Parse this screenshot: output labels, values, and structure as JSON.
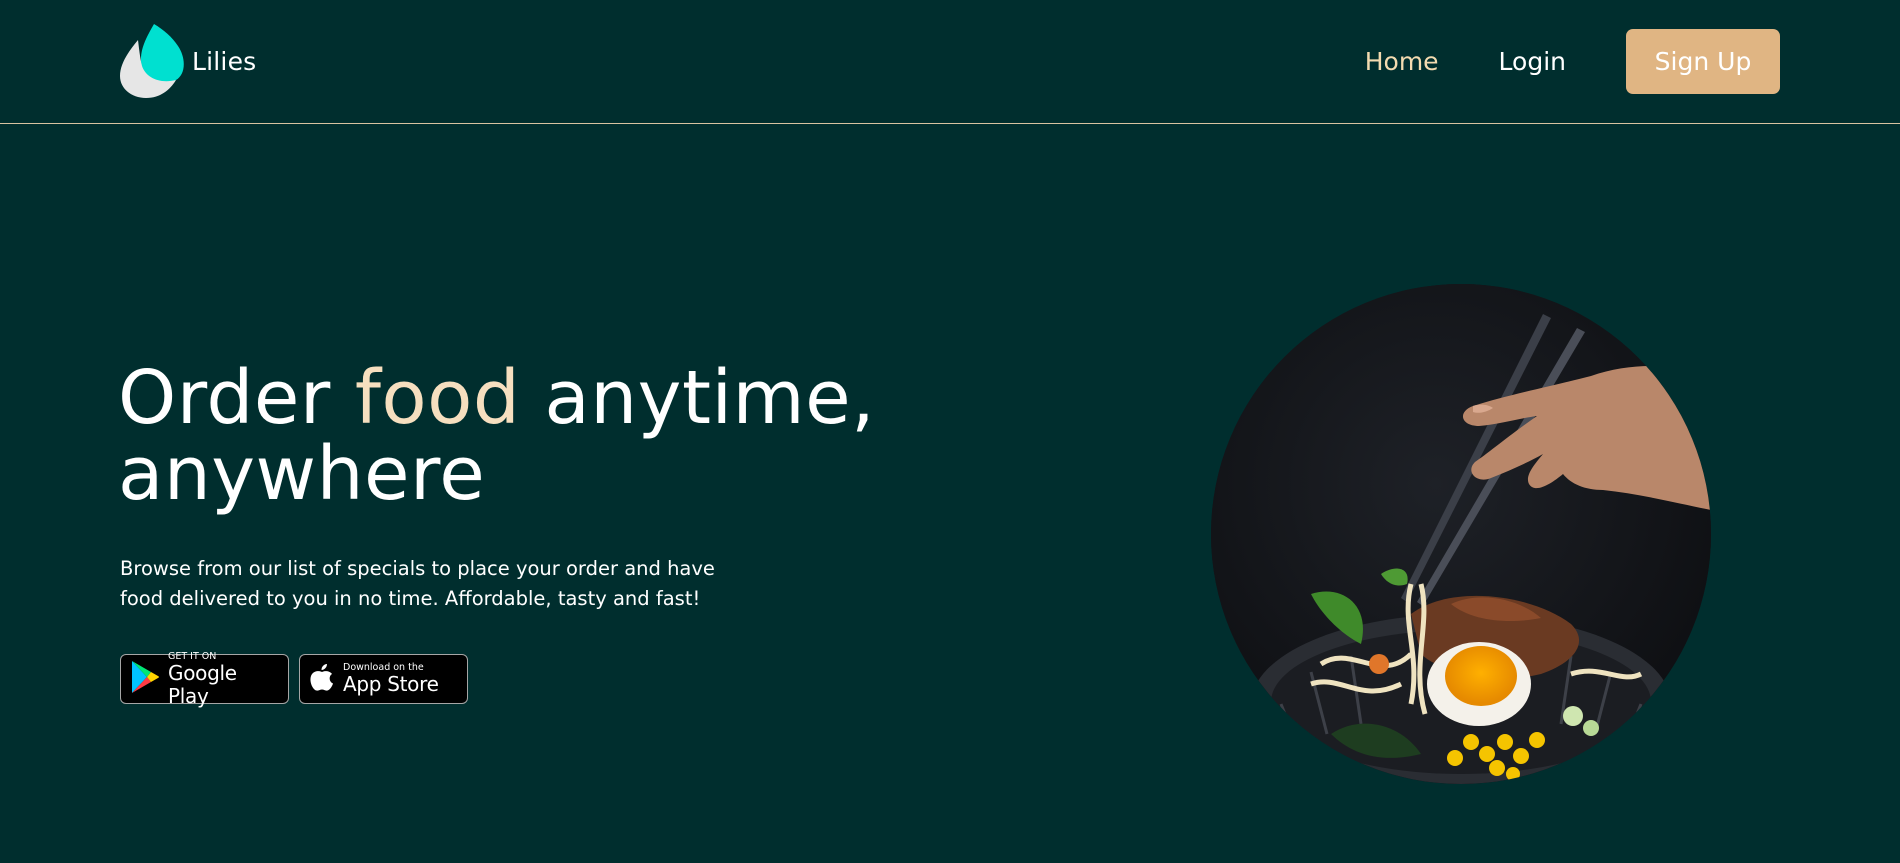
{
  "brand": {
    "name": "Lilies",
    "logo_icon": "leaf-drop-logo-icon",
    "logo_colors": [
      "#00e0d0",
      "#e6e6e6"
    ]
  },
  "nav": {
    "home": "Home",
    "login": "Login",
    "signup": "Sign Up"
  },
  "hero": {
    "title_before": "Order ",
    "title_accent": "food",
    "title_after": " anytime,",
    "title_line2": "anywhere",
    "description": "Browse from our list of specials to place your order and have food delivered to you in no time. Affordable, tasty and fast!"
  },
  "stores": {
    "google": {
      "small": "GET IT ON",
      "large": "Google Play",
      "icon": "google-play-icon"
    },
    "apple": {
      "small": "Download on the",
      "large": "App Store",
      "icon": "apple-icon"
    }
  },
  "image": {
    "subject": "ramen-bowl-photo"
  },
  "colors": {
    "background": "#002e2e",
    "accent": "#e0b583",
    "accent_text": "#f6dfbf",
    "nav_active": "#f3dbb0",
    "divider": "#d9c3a1"
  }
}
